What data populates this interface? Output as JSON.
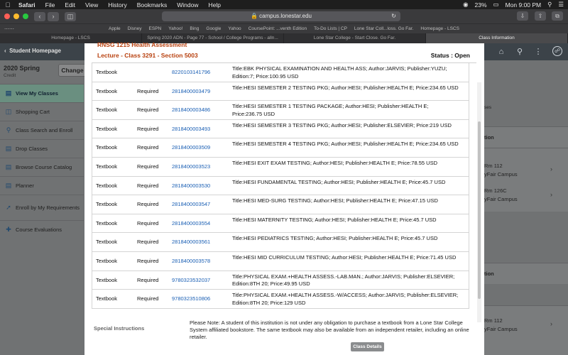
{
  "menubar": {
    "app": "Safari",
    "items": [
      "File",
      "Edit",
      "View",
      "History",
      "Bookmarks",
      "Window",
      "Help"
    ],
    "battery": "23%",
    "clock": "Mon 9:00 PM"
  },
  "browser": {
    "url": "campus.lonestar.edu",
    "favorites": [
      "Apple",
      "Disney",
      "ESPN",
      "Yahoo!",
      "Bing",
      "Google",
      "Yahoo",
      "CoursePoint: ...venth Edition",
      "To-Do Lists | CP",
      "Lone Star Coll...loss. Go Far.",
      "Homepage - LSCS"
    ],
    "tabs": [
      {
        "label": "Homepage - LSCS",
        "active": false
      },
      {
        "label": "Spring 2020 ADN - Page 77 - School / College Programs - alln...",
        "active": false
      },
      {
        "label": "Lone Star College - Start Close. Go Far.",
        "active": false
      },
      {
        "label": "Class Information",
        "active": true
      }
    ]
  },
  "background": {
    "back_label": "Student Homepage",
    "term": "2020 Spring",
    "term_sub": "Credit",
    "change_label": "Change",
    "sidebar": [
      {
        "label": "View My Classes",
        "icon": "book-icon",
        "active": true
      },
      {
        "label": "Shopping Cart",
        "icon": "cart-icon",
        "active": false
      },
      {
        "label": "Class Search and Enroll",
        "icon": "search-icon",
        "active": false
      },
      {
        "label": "Drop Classes",
        "icon": "drop-icon",
        "active": false
      },
      {
        "label": "Browse Course Catalog",
        "icon": "catalog-icon",
        "active": false
      },
      {
        "label": "Planner",
        "icon": "planner-icon",
        "active": false
      },
      {
        "label": "Enroll by My Requirements",
        "icon": "chart-icon",
        "active": false
      },
      {
        "label": "Course Evaluations",
        "icon": "evaluation-icon",
        "active": false
      }
    ],
    "right": {
      "partial1": "ses",
      "partial2": "tion",
      "block1_line1": "Rm 112",
      "block1_line2": "yFair Campus",
      "block2_line1": "Rm 126C",
      "block2_line2": "yFair Campus",
      "partial3": "tion",
      "block3_line1": "Rm 112",
      "block3_line2": "yFair Campus"
    }
  },
  "modal": {
    "course_title": "RNSG 1215 Health Assessment",
    "lecture": "Lecture - Class 3291 - Section 5003",
    "status": "Status : Open",
    "rows": [
      {
        "type": "Textbook",
        "req": "",
        "isbn": "8220103141796",
        "desc": "Title:EBK PHYSICAL EXAMINATION AND HEALTH ASS; Author:JARVIS; Publisher:YUZU; Edition:7; Price:100.95 USD"
      },
      {
        "type": "Textbook",
        "req": "Required",
        "isbn": "2818400003479",
        "desc": "Title:HESI SEMESTER 2 TESTING PKG; Author:HESI; Publisher:HEALTH E; Price:234.65 USD"
      },
      {
        "type": "Textbook",
        "req": "Required",
        "isbn": "2818400003486",
        "desc": "Title:HESI SEMESTER 1 TESTING PACKAGE; Author:HESI; Publisher:HEALTH E; Price:236.75 USD"
      },
      {
        "type": "Textbook",
        "req": "Required",
        "isbn": "2818400003493",
        "desc": "Title:HESI SEMESTER 3 TESTING PKG; Author:HESI; Publisher:ELSEVIER; Price:219 USD"
      },
      {
        "type": "Textbook",
        "req": "Required",
        "isbn": "2818400003509",
        "desc": "Title:HESI SEMESTER 4 TESTING PKG; Author:HESI; Publisher:HEALTH E; Price:234.65 USD"
      },
      {
        "type": "Textbook",
        "req": "Required",
        "isbn": "2818400003523",
        "desc": "Title:HESI EXIT EXAM TESTING; Author:HESI; Publisher:HEALTH E; Price:78.55 USD"
      },
      {
        "type": "Textbook",
        "req": "Required",
        "isbn": "2818400003530",
        "desc": "Title:HESI FUNDAMENTAL TESTING; Author:HESI; Publisher:HEALTH E; Price:45.7 USD"
      },
      {
        "type": "Textbook",
        "req": "Required",
        "isbn": "2818400003547",
        "desc": "Title:HESI MED-SURG TESTING; Author:HESI; Publisher:HEALTH E; Price:47.15 USD"
      },
      {
        "type": "Textbook",
        "req": "Required",
        "isbn": "2818400003554",
        "desc": "Title:HESI MATERNITY TESTING; Author:HESI; Publisher:HEALTH E; Price:45.7 USD"
      },
      {
        "type": "Textbook",
        "req": "Required",
        "isbn": "2818400003561",
        "desc": "Title:HESI PEDIATRICS TESTING; Author:HESI; Publisher:HEALTH E; Price:45.7 USD"
      },
      {
        "type": "Textbook",
        "req": "Required",
        "isbn": "2818400003578",
        "desc": "Title:HESI MID CURRICULUM TESTING; Author:HESI; Publisher:HEALTH E; Price:71.45 USD"
      },
      {
        "type": "Textbook",
        "req": "Required",
        "isbn": "9780323532037",
        "desc": "Title:PHYSICAL EXAM.+HEALTH ASSESS.-LAB.MAN.; Author:JARVIS; Publisher:ELSEVIER; Edition:8TH 20; Price:49.95 USD"
      },
      {
        "type": "Textbook",
        "req": "Required",
        "isbn": "9780323510806",
        "desc": "Title:PHYSICAL EXAM.+HEALTH ASSESS.-W/ACCESS; Author:JARVIS; Publisher:ELSEVIER; Edition:8TH 20; Price:129 USD"
      }
    ],
    "special_label": "Special Instructions",
    "note": "Please Note:  A student of this institution is not under any obligation to purchase a textbook from a Lone Star College System affiliated bookstore.  The same textbook may also be available from an independent retailer, including an online retailer.",
    "class_details_label": "Class Details"
  }
}
